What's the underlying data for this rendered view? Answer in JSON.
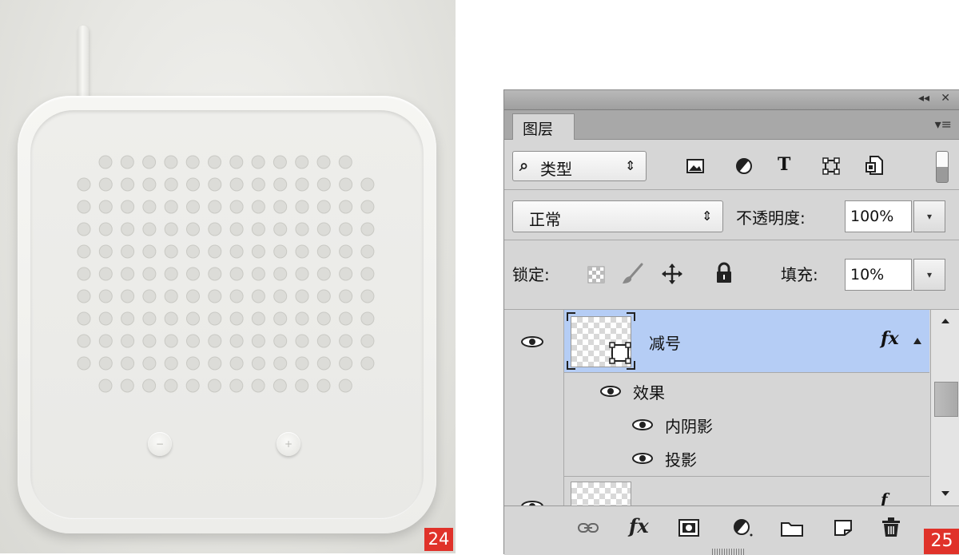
{
  "render": {
    "badge": "24",
    "minus_label": "−",
    "plus_label": "+"
  },
  "panel": {
    "badge": "25",
    "collapse_icon": "◂◂",
    "close_icon": "✕",
    "tab_label": "图层",
    "menu_icon": "▾≡",
    "filter": {
      "search_icon": "⌕",
      "kind_label": "类型",
      "stepper_glyph": "⇕",
      "icons": [
        "image-filter-icon",
        "adjustment-filter-icon",
        "type-filter-icon",
        "shape-filter-icon",
        "smart-object-filter-icon"
      ],
      "type_glyph": "T"
    },
    "blend": {
      "mode": "正常",
      "stepper_glyph": "⇕",
      "opacity_label": "不透明度:",
      "opacity_value": "100%",
      "dropdown_glyph": "▾"
    },
    "lock": {
      "label": "锁定:",
      "fill_label": "填充:",
      "fill_value": "10%",
      "dropdown_glyph": "▾"
    },
    "layers": {
      "selected_name": "减号",
      "fx_badge": "fx",
      "effects_label": "效果",
      "effect_items": [
        "内阴影",
        "投影"
      ],
      "next_layer_fx": "f"
    },
    "footer_icons": [
      "link-icon",
      "fx-icon",
      "mask-icon",
      "adjustment-icon",
      "folder-icon",
      "new-layer-icon",
      "trash-icon"
    ],
    "footer_fx_label": "fx"
  }
}
